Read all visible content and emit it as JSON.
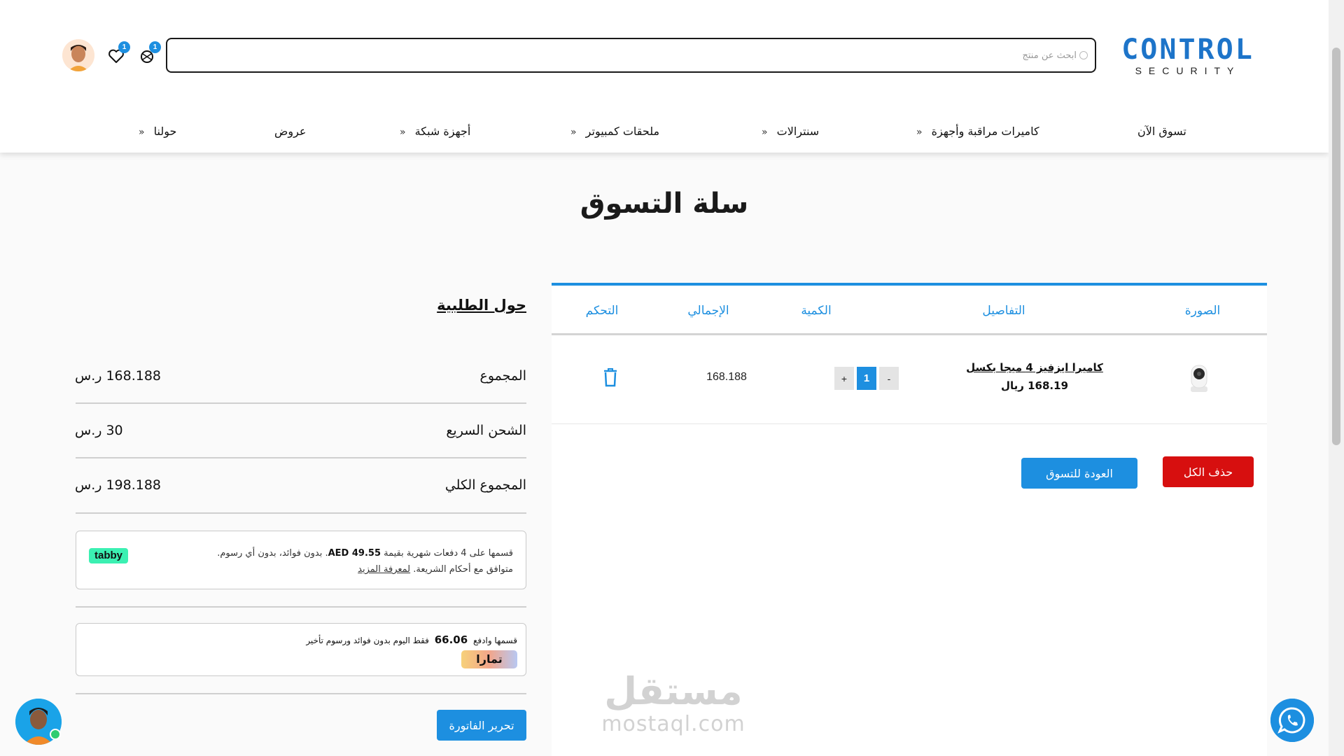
{
  "header": {
    "logo_main": "CONTROL",
    "logo_sub": "SECURITY",
    "search_placeholder": "ابحث عن منتج",
    "cart_count": "1",
    "wishlist_count": "1"
  },
  "nav": {
    "items": [
      "تسوق الآن",
      "كاميرات مراقبة وأجهزة",
      "سنترالات",
      "ملحقات كمبيوتر",
      "أجهزة شبكة",
      "عروض",
      "حولنا"
    ],
    "chevron": "«"
  },
  "page_title": "سلة التسوق",
  "cart": {
    "headers": [
      "الصورة",
      "التفاصيل",
      "الكمية",
      "الإجمالي",
      "التحكم"
    ],
    "items": [
      {
        "name": "كاميرا ايزفيز 4 ميجا بكسل",
        "price": "168.19 ريال",
        "quantity": "1",
        "total": "168.188"
      }
    ],
    "qty_minus": "-",
    "qty_plus": "+",
    "delete_all": "حذف الكل",
    "back_to_shop": "العودة للتسوق"
  },
  "summary": {
    "title": "حول الطلبية",
    "subtotal_label": "المجموع",
    "subtotal_value": "168.188 ر.س",
    "shipping_label": "الشحن السريع",
    "shipping_value": "30 ر.س",
    "total_label": "المجموع الكلي",
    "total_value": "198.188 ر.س",
    "invoice_button": "تحرير الفاتورة"
  },
  "tabby": {
    "logo": "tabby",
    "line1_start": "قسمها على 4 دفعات شهرية بقيمة",
    "amount": "AED 49.55",
    "line1_end": ". بدون فوائد، بدون أي رسوم.",
    "line2": "متوافق مع أحكام الشريعة.",
    "link": "لمعرفة المزيد"
  },
  "tamara": {
    "text_start": "قسمها وادفع",
    "amount": "66.06",
    "text_end": "فقط اليوم بدون فوائد ورسوم تأخير",
    "logo": "تمارا"
  },
  "watermark": {
    "ar": "مستقل",
    "en": "mostaql.com"
  },
  "colors": {
    "brand_blue": "#1d8fe0",
    "danger_red": "#d70f0f",
    "tabby_green": "#3bf0b2"
  }
}
